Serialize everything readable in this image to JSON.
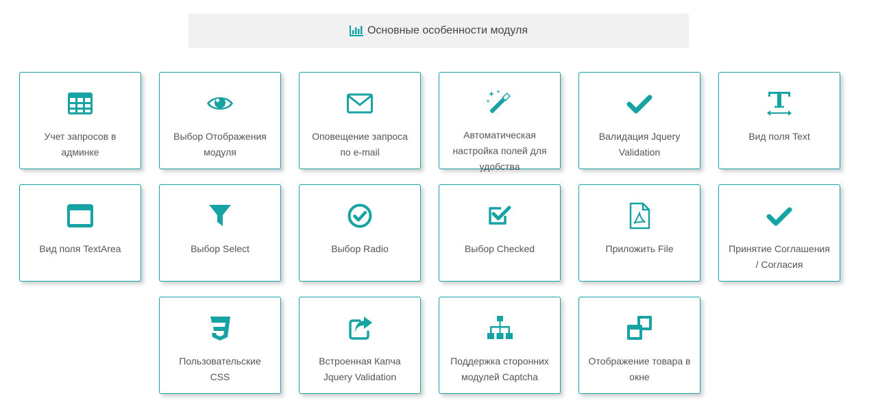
{
  "header": {
    "title": "Основные особенности модуля",
    "icon": "bar-chart-icon"
  },
  "accent_color": "#17a2a3",
  "features": [
    {
      "label": "Учет запросов в админке",
      "icon": "table-icon"
    },
    {
      "label": "Выбор Отображения модуля",
      "icon": "eye-icon"
    },
    {
      "label": "Оповещение запроса по e-mail",
      "icon": "envelope-icon"
    },
    {
      "label": "Автоматическая настройка полей для удобства",
      "icon": "magic-wand-icon"
    },
    {
      "label": "Валидация Jquery Validation",
      "icon": "check-icon"
    },
    {
      "label": "Вид поля Text",
      "icon": "text-height-icon"
    },
    {
      "label": "Вид поля TextArea",
      "icon": "window-icon"
    },
    {
      "label": "Выбор Select",
      "icon": "filter-icon"
    },
    {
      "label": "Выбор Radio",
      "icon": "check-circle-icon"
    },
    {
      "label": "Выбор Checked",
      "icon": "check-square-icon"
    },
    {
      "label": "Приложить File",
      "icon": "file-pdf-icon"
    },
    {
      "label": "Принятие Соглашения / Согласия",
      "icon": "check-icon"
    },
    {
      "label": "Пользовательские CSS",
      "icon": "css3-icon"
    },
    {
      "label": "Встроенная Капча Jquery Validation",
      "icon": "share-square-icon"
    },
    {
      "label": "Поддержка сторонних модулей Captcha",
      "icon": "sitemap-icon"
    },
    {
      "label": "Отображение товара в окне",
      "icon": "clone-icon"
    }
  ]
}
